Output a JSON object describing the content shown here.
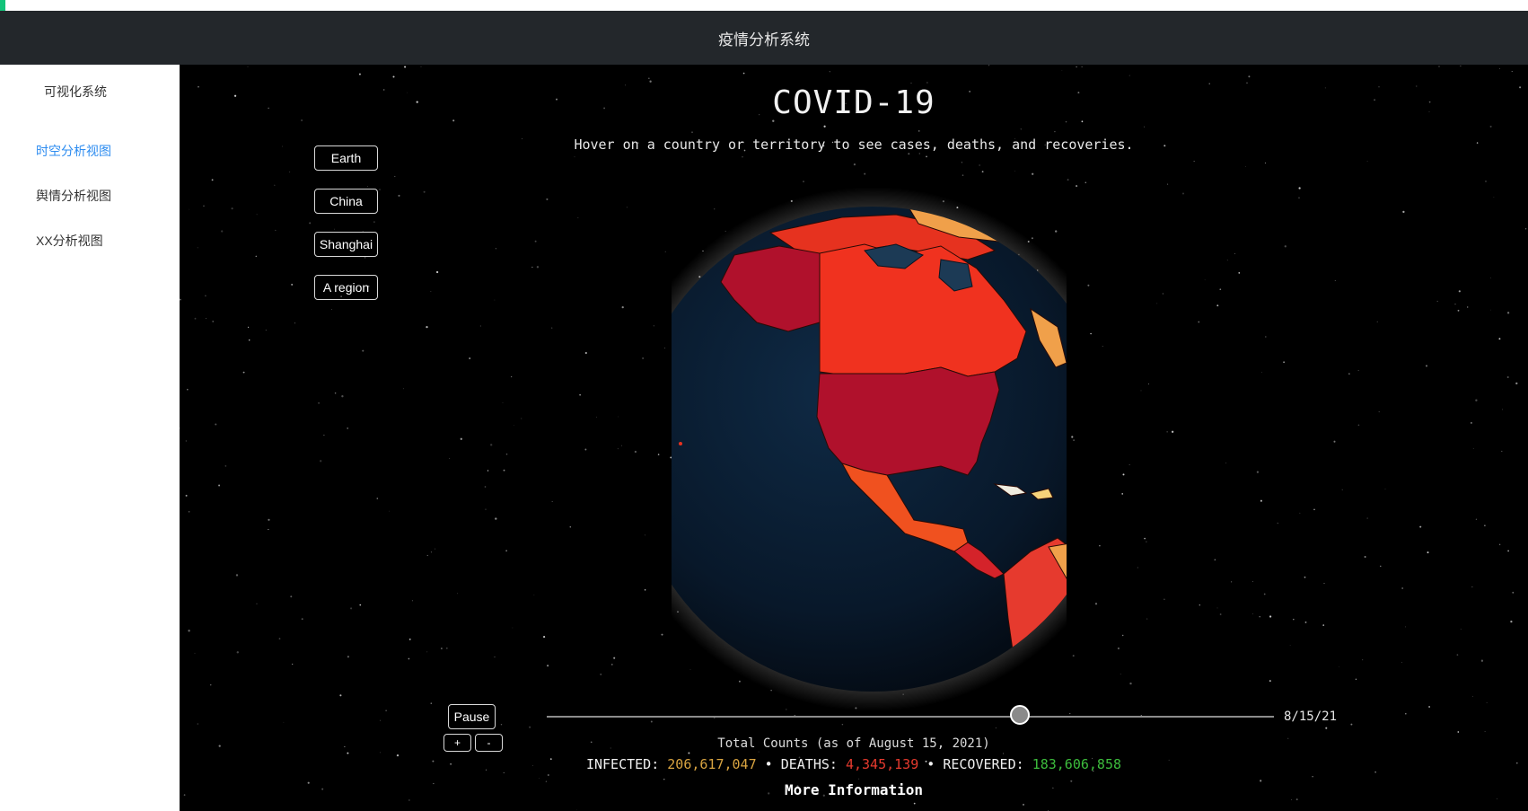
{
  "header": {
    "title": "疫情分析系统"
  },
  "sidebar": {
    "brand": "可视化系统",
    "items": [
      {
        "label": "时空分析视图",
        "active": true
      },
      {
        "label": "舆情分析视图",
        "active": false
      },
      {
        "label": "XX分析视图",
        "active": false
      }
    ]
  },
  "view_buttons": [
    {
      "label": "Earth"
    },
    {
      "label": "China"
    },
    {
      "label": "Shanghai"
    },
    {
      "label": "A region"
    }
  ],
  "main": {
    "title": "COVID-19",
    "subtitle": "Hover on a country or territory to see cases, deaths, and recoveries."
  },
  "playback": {
    "pause_label": "Pause",
    "zoom_in_label": "+",
    "zoom_out_label": "-",
    "date": "8/15/21",
    "progress": 0.65
  },
  "totals": {
    "heading": "Total Counts (as of August 15, 2021)",
    "infected_label": "INFECTED:",
    "infected": "206,617,047",
    "deaths_label": "DEATHS:",
    "deaths": "4,345,139",
    "recovered_label": "RECOVERED:",
    "recovered": "183,606,858",
    "separator": "•",
    "more_info": "More Information"
  },
  "colors": {
    "infected": "#d9a441",
    "deaths": "#e63a2e",
    "recovered": "#3dbd3d",
    "active_nav": "#2d8cf0",
    "accent": "#13c37a"
  }
}
